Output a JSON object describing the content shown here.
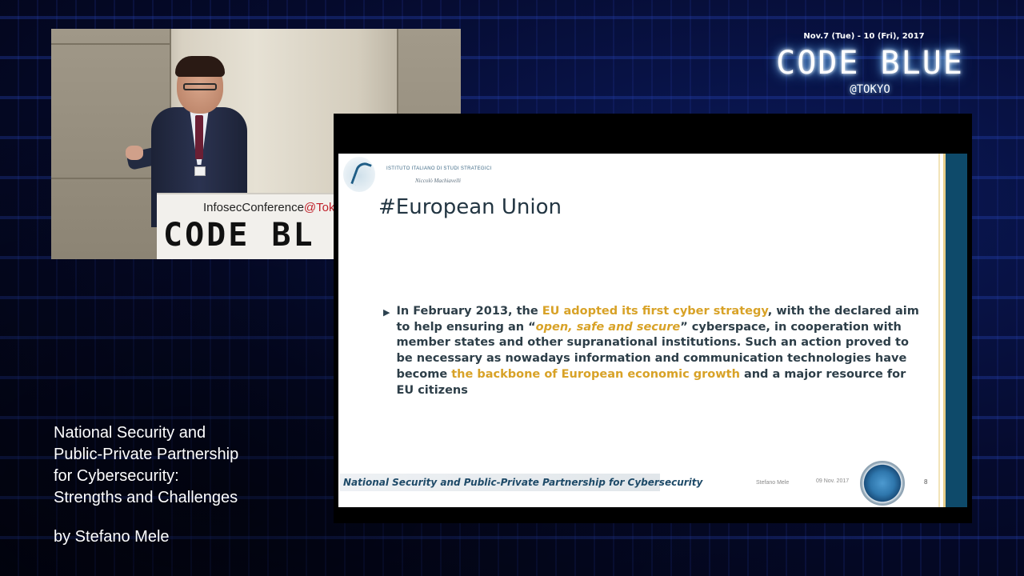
{
  "event": {
    "date": "Nov.7 (Tue) - 10 (Fri), 2017",
    "name": "CODE BLUE",
    "location": "@TOKYO"
  },
  "camera": {
    "podium_line1_prefix": "InfosecConference",
    "podium_line1_accent": "@Tok",
    "podium_line2": "CODE BL"
  },
  "talk": {
    "title_lines": [
      "National Security and",
      "Public-Private Partnership",
      "for Cybersecurity:",
      "Strengths and Challenges"
    ],
    "author": "by Stefano Mele"
  },
  "slide": {
    "institute_name": "ISTITUTO ITALIANO DI STUDI STRATEGICI",
    "signature": "Niccolò Machiavelli",
    "title": "#European Union",
    "bullet": {
      "t1": "In February 2013, the ",
      "h1": "EU adopted its first cyber strategy",
      "t2": ", with the declared aim to help ensuring an “",
      "h2": "open, safe and secure",
      "t3": "”  cyberspace, in cooperation with member states and other supranational institutions. Such an action proved to be necessary as nowadays information and communication technologies have become ",
      "h3": "the backbone of European economic growth",
      "t4": " and a major resource for EU citizens"
    },
    "footer_title": "National Security and Public-Private Partnership for Cybersecurity",
    "footer_author": "Stefano Mele",
    "footer_date": "09 Nov. 2017",
    "page_number": "8"
  },
  "colors": {
    "background": "#03061a",
    "slide_accent_text": "#d8a227",
    "slide_rail": "#0e4a6a",
    "logo_glow": "#8fd0ff"
  }
}
